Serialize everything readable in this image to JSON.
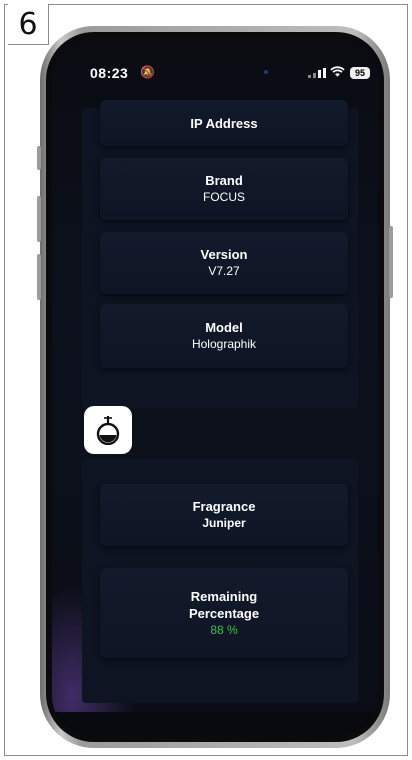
{
  "step_number": "6",
  "status_bar": {
    "time": "08:23",
    "battery": "95",
    "icons": [
      "mute-icon",
      "signal-icon",
      "wifi-icon",
      "battery-icon"
    ]
  },
  "device_info": [
    {
      "title": "IP Address",
      "value": ""
    },
    {
      "title": "Brand",
      "value": "FOCUS"
    },
    {
      "title": "Version",
      "value": "V7.27"
    },
    {
      "title": "Model",
      "value": "Holographik"
    }
  ],
  "fragrance": {
    "app_icon": "perfume-bottle-icon",
    "title": "Fragrance",
    "value": "Juniper"
  },
  "remaining": {
    "title_line1": "Remaining",
    "title_line2": "Percentage",
    "value": "88 %",
    "value_color": "#3fbf4a"
  }
}
